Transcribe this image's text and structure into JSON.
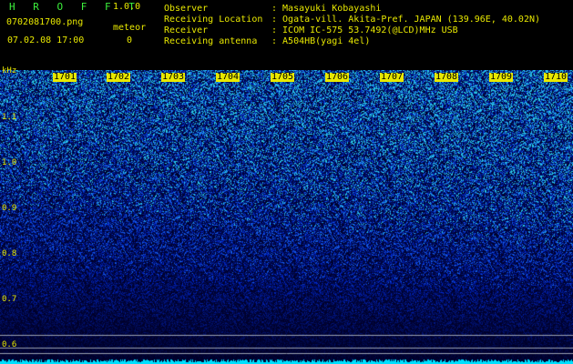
{
  "header": {
    "app_title": "H R O F F T",
    "version": "1.0.0",
    "filename": "0702081700.png",
    "datetime": "07.02.08 17:00",
    "meteor_label": "meteor",
    "meteor_count": "0"
  },
  "info": [
    {
      "label": "Observer",
      "value": ": Masayuki Kobayashi"
    },
    {
      "label": "Receiving Location",
      "value": ": Ogata-vill. Akita-Pref. JAPAN (139.96E, 40.02N)"
    },
    {
      "label": "Receiver",
      "value": ": ICOM IC-575 53.7492(@LCD)MHz USB"
    },
    {
      "label": "Receiving antenna",
      "value": ": A504HB(yagi 4el)"
    }
  ],
  "axis": {
    "unit": "kHz",
    "freq_labels": [
      "1.1",
      "1.0",
      "0.9",
      "0.8",
      "0.7",
      "0.6"
    ],
    "time_labels": [
      "1701",
      "1702",
      "1703",
      "1704",
      "1705",
      "1706",
      "1707",
      "1708",
      "1709",
      "1710"
    ]
  },
  "colors": {
    "background": "#000000",
    "text": "#e8e800",
    "title": "#3cf03c",
    "signal": "#00e0ff"
  }
}
